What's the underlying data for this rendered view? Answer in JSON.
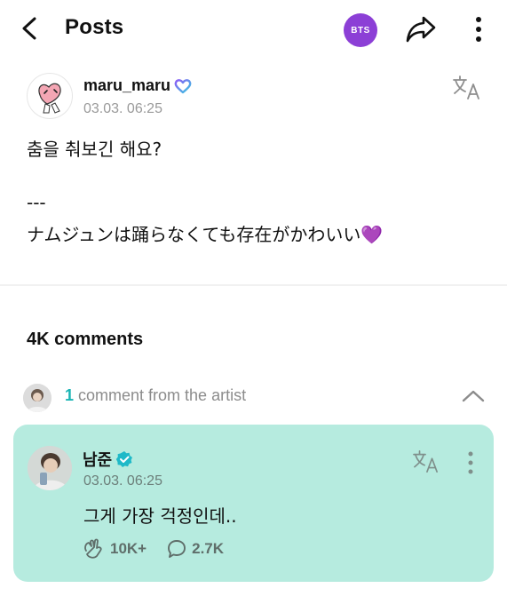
{
  "header": {
    "title": "Posts",
    "community_badge": "BTS",
    "back_icon": "chevron-left-icon",
    "share_icon": "share-icon",
    "more_icon": "more-vertical-icon"
  },
  "post": {
    "author": "maru_maru",
    "date": "03.03. 06:25",
    "lines": [
      "춤을 춰보긴 해요?",
      "---",
      "ナムジュンは踊らなくても存在がかわいい💜"
    ],
    "translate_icon": "translate-icon"
  },
  "comments": {
    "count_label": "4K comments",
    "artist_count": "1",
    "artist_label": " comment from the artist"
  },
  "artist_comment": {
    "name": "남준",
    "date": "03.03. 06:25",
    "text": "그게 가장 걱정인데..",
    "likes": "10K+",
    "replies": "2.7K"
  },
  "colors": {
    "accent_purple": "#8c3fd6",
    "artist_card_bg": "#b6ebdf",
    "artist_count_teal": "#19b4b4"
  }
}
